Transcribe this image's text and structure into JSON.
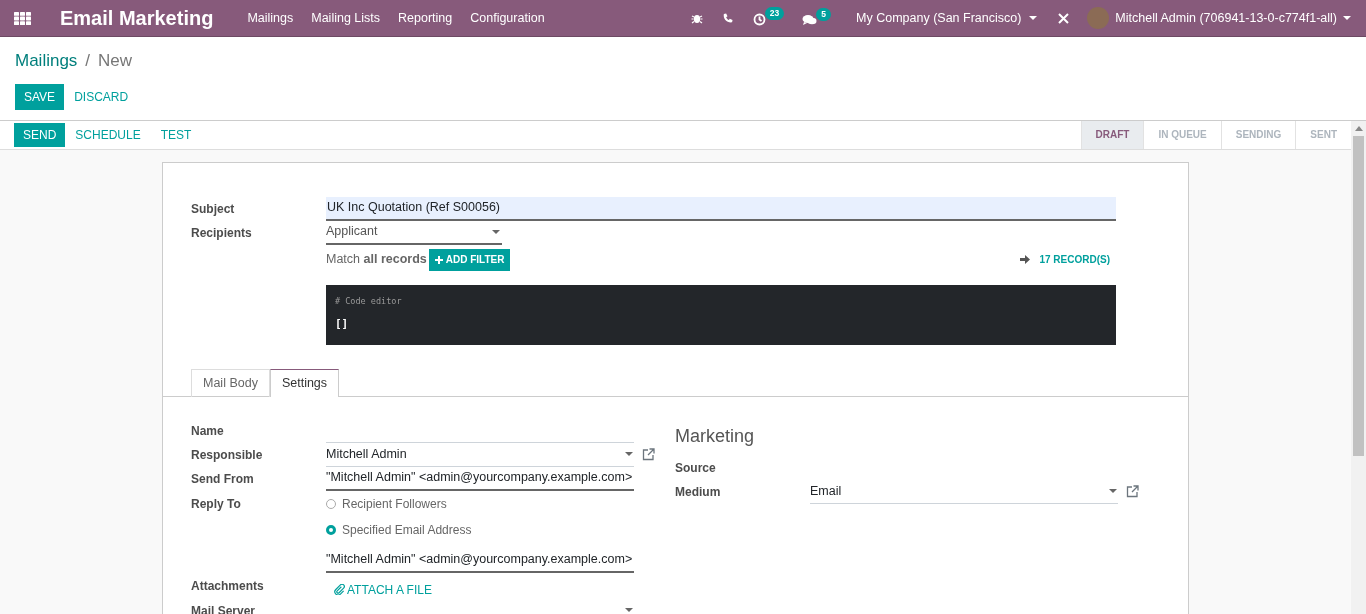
{
  "navbar": {
    "app_title": "Email Marketing",
    "menu": [
      "Mailings",
      "Mailing Lists",
      "Reporting",
      "Configuration"
    ],
    "activity_count": "23",
    "message_count": "5",
    "company": "My Company (San Francisco)",
    "user": "Mitchell Admin (706941-13-0-c774f1-all)"
  },
  "breadcrumb": {
    "parent": "Mailings",
    "separator": "/",
    "current": "New"
  },
  "edit_buttons": [
    {
      "label": "SAVE",
      "kind": "primary"
    },
    {
      "label": "DISCARD",
      "kind": "link"
    }
  ],
  "actions": [
    {
      "label": "SEND",
      "kind": "primary"
    },
    {
      "label": "SCHEDULE",
      "kind": "link"
    },
    {
      "label": "TEST",
      "kind": "link"
    }
  ],
  "stages": [
    {
      "label": "DRAFT",
      "selected": true
    },
    {
      "label": "IN QUEUE",
      "selected": false
    },
    {
      "label": "SENDING",
      "selected": false
    },
    {
      "label": "SENT",
      "selected": false
    }
  ],
  "form": {
    "subject_label": "Subject",
    "subject": "UK Inc Quotation (Ref S00056)",
    "recipients_label": "Recipients",
    "recipients": "Applicant",
    "match_text": "Match **all records**",
    "add_filter": "ADD FILTER",
    "records": "17 RECORD(S)",
    "code_comment": "# Code editor",
    "code_value": "[]"
  },
  "tabs": [
    {
      "label": "Mail Body",
      "selected": false
    },
    {
      "label": "Settings",
      "selected": true
    }
  ],
  "settings": [
    {
      "kind": "text",
      "label": "Name"
    },
    {
      "kind": "select",
      "label": "Responsible",
      "value": "Mitchell Admin",
      "link": true
    },
    {
      "kind": "text",
      "label": "Send From",
      "value": "\"Mitchell Admin\" <admin@yourcompany.example.com>"
    },
    {
      "kind": "radio",
      "label": "Reply To",
      "options": [
        {
          "label": "Recipient Followers",
          "selected": false
        },
        {
          "label": "Specified Email Address",
          "selected": true
        }
      ],
      "value": "\"Mitchell Admin\" <admin@yourcompany.example.com>"
    },
    {
      "kind": "attach",
      "label": "Attachments",
      "button": "ATTACH A FILE"
    },
    {
      "kind": "select",
      "label": "Mail Server"
    }
  ],
  "marketing": {
    "title": "Marketing",
    "fields": [
      {
        "kind": "empty",
        "label": "Source"
      },
      {
        "kind": "select",
        "label": "Medium",
        "value": "Email",
        "link": true
      }
    ]
  }
}
